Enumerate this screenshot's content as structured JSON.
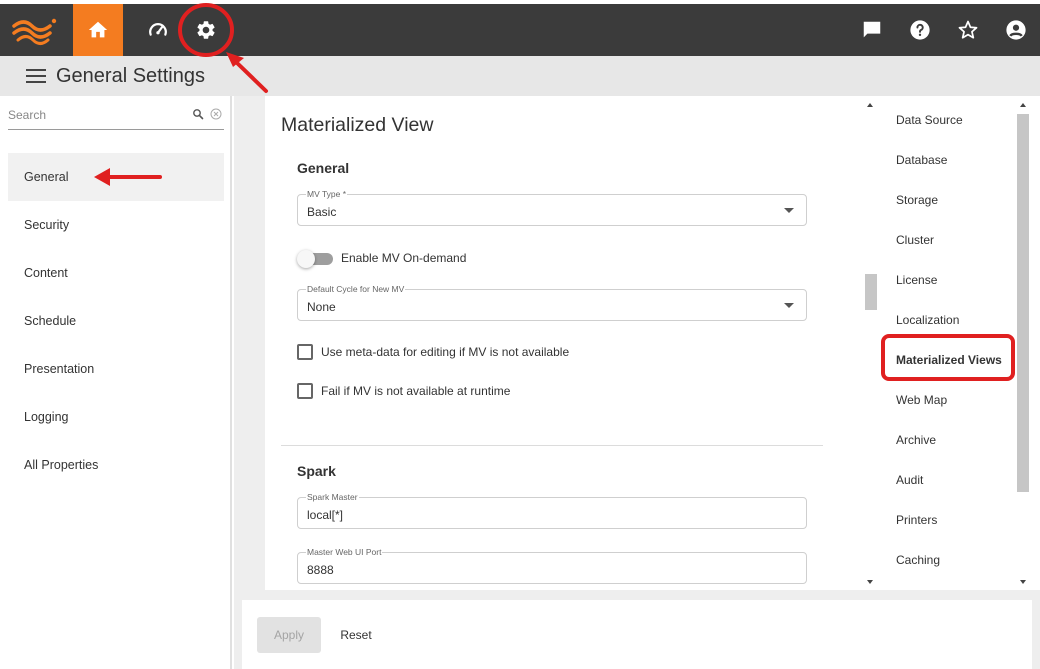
{
  "app": {
    "title": "General Settings",
    "colors": {
      "topbar": "#3b3b3b",
      "accent": "#f47c20",
      "annotation": "#e02020"
    }
  },
  "topbar": {
    "nav": [
      {
        "name": "home",
        "icon": "home-icon",
        "active": true
      },
      {
        "name": "dashboard",
        "icon": "speedometer-icon",
        "active": false
      },
      {
        "name": "settings",
        "icon": "gear-icon",
        "active": false
      }
    ],
    "right_icons": [
      "chat-icon",
      "help-icon",
      "star-icon",
      "account-icon"
    ]
  },
  "sidebar": {
    "search_placeholder": "Search",
    "items": [
      {
        "label": "General",
        "active": true
      },
      {
        "label": "Security"
      },
      {
        "label": "Content"
      },
      {
        "label": "Schedule"
      },
      {
        "label": "Presentation"
      },
      {
        "label": "Logging"
      },
      {
        "label": "All Properties"
      }
    ]
  },
  "main": {
    "title": "Materialized View",
    "general": {
      "title": "General",
      "mv_type": {
        "label": "MV Type *",
        "value": "Basic"
      },
      "toggle_label": "Enable MV On-demand",
      "default_cycle": {
        "label": "Default Cycle for New MV",
        "value": "None"
      },
      "check_meta": "Use meta-data for editing if MV is not available",
      "check_fail": "Fail if MV is not available at runtime"
    },
    "spark": {
      "title": "Spark",
      "master": {
        "label": "Spark Master",
        "value": "local[*]"
      },
      "port": {
        "label": "Master Web UI Port",
        "value": "8888"
      }
    }
  },
  "right_nav": {
    "items": [
      {
        "label": "Data Source"
      },
      {
        "label": "Database"
      },
      {
        "label": "Storage"
      },
      {
        "label": "Cluster"
      },
      {
        "label": "License"
      },
      {
        "label": "Localization"
      },
      {
        "label": "Materialized Views",
        "active": true
      },
      {
        "label": "Web Map"
      },
      {
        "label": "Archive"
      },
      {
        "label": "Audit"
      },
      {
        "label": "Printers"
      },
      {
        "label": "Caching"
      }
    ]
  },
  "footer": {
    "apply": "Apply",
    "reset": "Reset"
  }
}
